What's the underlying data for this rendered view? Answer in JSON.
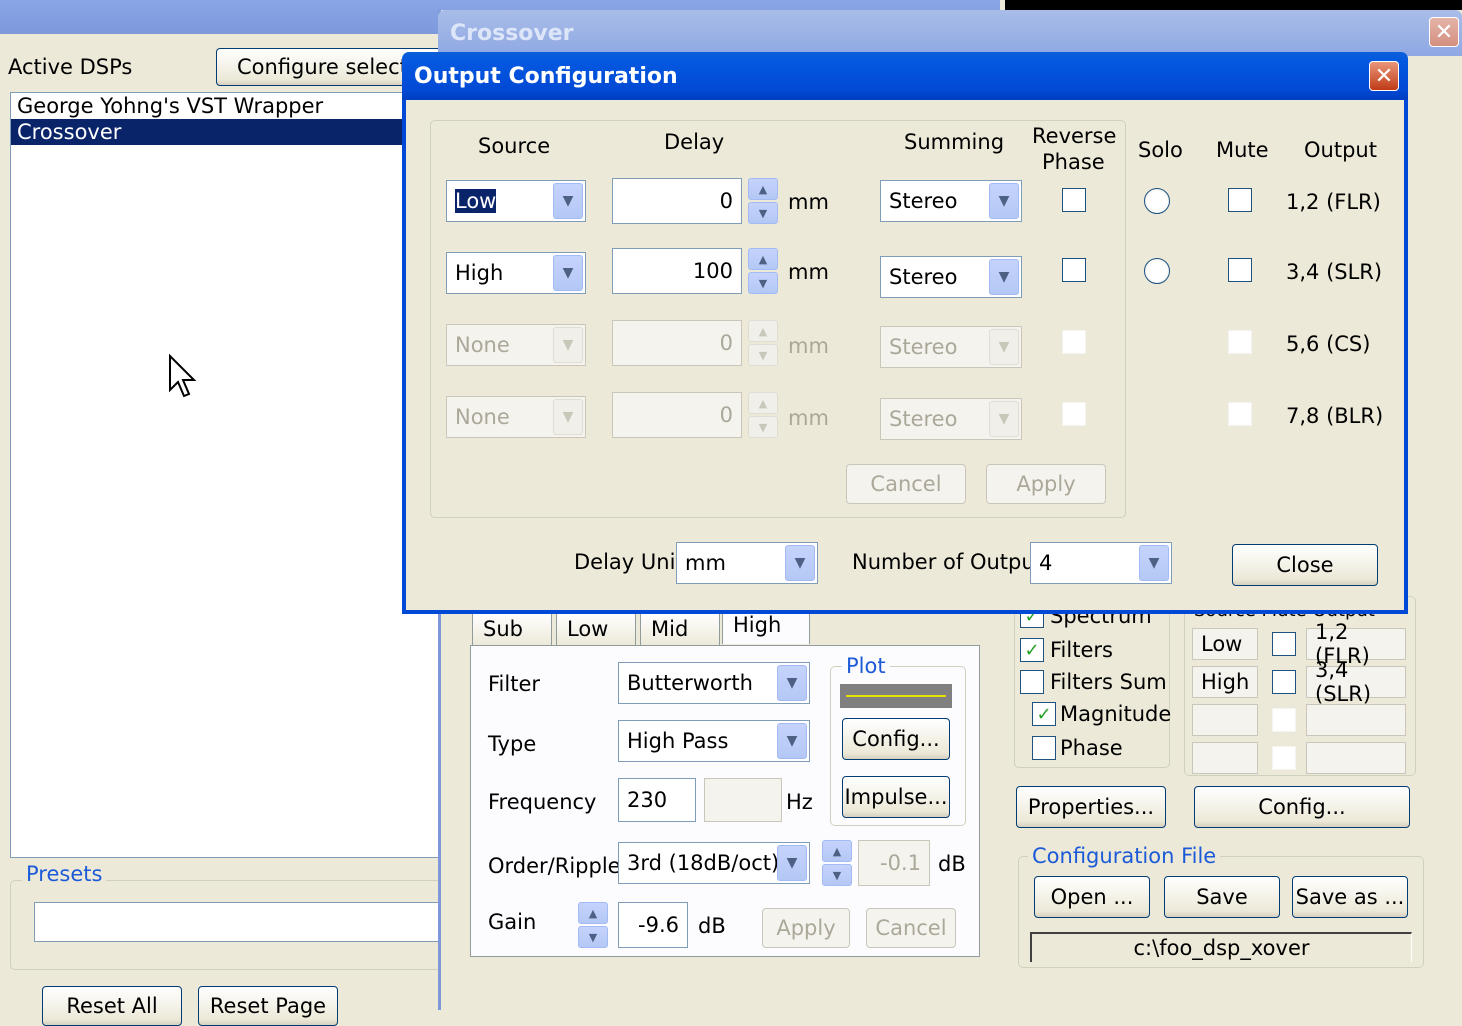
{
  "left_panel": {
    "active_dsps_label": "Active DSPs",
    "configure_button": "Configure selecte",
    "dsp_list": [
      "George Yohng's VST Wrapper",
      "Crossover"
    ],
    "presets_title": "Presets",
    "preset_value": "",
    "reset_all": "Reset All",
    "reset_page": "Reset Page"
  },
  "crossover_window": {
    "title": "Crossover",
    "tabs": [
      "Sub",
      "Low",
      "Mid",
      "High"
    ],
    "active_tab": "High",
    "filter_label": "Filter",
    "filter_value": "Butterworth",
    "type_label": "Type",
    "type_value": "High Pass",
    "frequency_label": "Frequency",
    "frequency_value": "230",
    "frequency_unit": "Hz",
    "order_label": "Order/Ripple",
    "order_value": "3rd (18dB/oct)",
    "ripple_value": "-0.1",
    "ripple_unit": "dB",
    "gain_label": "Gain",
    "gain_value": "-9.6",
    "gain_unit": "dB",
    "apply": "Apply",
    "cancel": "Cancel",
    "plot_title": "Plot",
    "plot_line_color": "#e8e000",
    "config_button": "Config...",
    "impulse_button": "Impulse...",
    "plot_options": [
      {
        "label": "Spectrum",
        "checked": true
      },
      {
        "label": "Filters",
        "checked": true
      },
      {
        "label": "Filters Sum",
        "checked": false
      },
      {
        "label": "Magnitude",
        "checked": true
      },
      {
        "label": "Phase",
        "checked": false
      }
    ],
    "properties_button": "Properties...",
    "output_header": "Source Mute Output",
    "output_rows": [
      {
        "source": "Low",
        "output": "1,2 (FLR)"
      },
      {
        "source": "High",
        "output": "3,4 (SLR)"
      },
      {
        "source": "",
        "output": ""
      },
      {
        "source": "",
        "output": ""
      }
    ],
    "outputs_config_button": "Config...",
    "config_file_title": "Configuration File",
    "open_button": "Open ...",
    "save_button": "Save",
    "save_as_button": "Save as ...",
    "config_path": "c:\\foo_dsp_xover"
  },
  "output_dialog": {
    "title": "Output Configuration",
    "headers": {
      "source": "Source",
      "delay": "Delay",
      "summing": "Summing",
      "reverse_phase_1": "Reverse",
      "reverse_phase_2": "Phase",
      "solo": "Solo",
      "mute": "Mute",
      "output": "Output"
    },
    "rows": [
      {
        "source": "Low",
        "delay": "0",
        "unit": "mm",
        "summing": "Stereo",
        "output": "1,2 (FLR)",
        "enabled": true
      },
      {
        "source": "High",
        "delay": "100",
        "unit": "mm",
        "summing": "Stereo",
        "output": "3,4 (SLR)",
        "enabled": true
      },
      {
        "source": "None",
        "delay": "0",
        "unit": "mm",
        "summing": "Stereo",
        "output": "5,6 (CS)",
        "enabled": false
      },
      {
        "source": "None",
        "delay": "0",
        "unit": "mm",
        "summing": "Stereo",
        "output": "7,8 (BLR)",
        "enabled": false
      }
    ],
    "cancel": "Cancel",
    "apply": "Apply",
    "delay_unit_label": "Delay Unit",
    "delay_unit_value": "mm",
    "num_output_label": "Number of Output",
    "num_output_value": "4",
    "close": "Close"
  }
}
